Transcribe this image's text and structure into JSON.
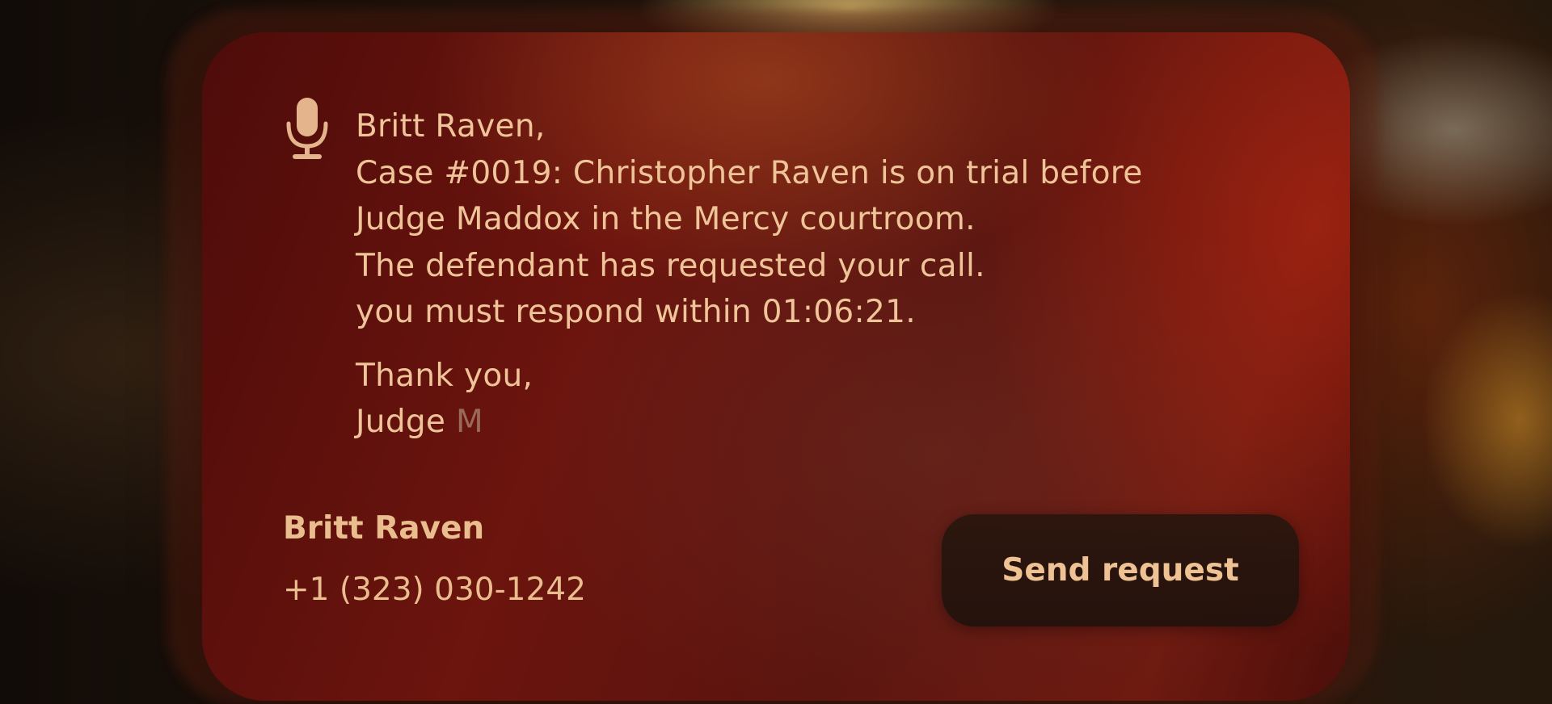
{
  "message": {
    "greeting": "Britt Raven,",
    "lines": [
      "Case #0019: Christopher Raven is on trial before",
      "Judge Maddox in the Mercy courtroom.",
      "The defendant has requested your call.",
      "you must respond within 01:06:21."
    ],
    "closing": "Thank you,",
    "signature_prefix": "Judge ",
    "signature_partial": "M"
  },
  "contact": {
    "name": "Britt Raven",
    "phone": "+1 (323) 030-1242"
  },
  "actions": {
    "send_label": "Send request"
  },
  "icons": {
    "dictation": "microphone-icon"
  },
  "colors": {
    "text": "#efc498",
    "card": "#6c140e",
    "button": "#2a160e"
  }
}
